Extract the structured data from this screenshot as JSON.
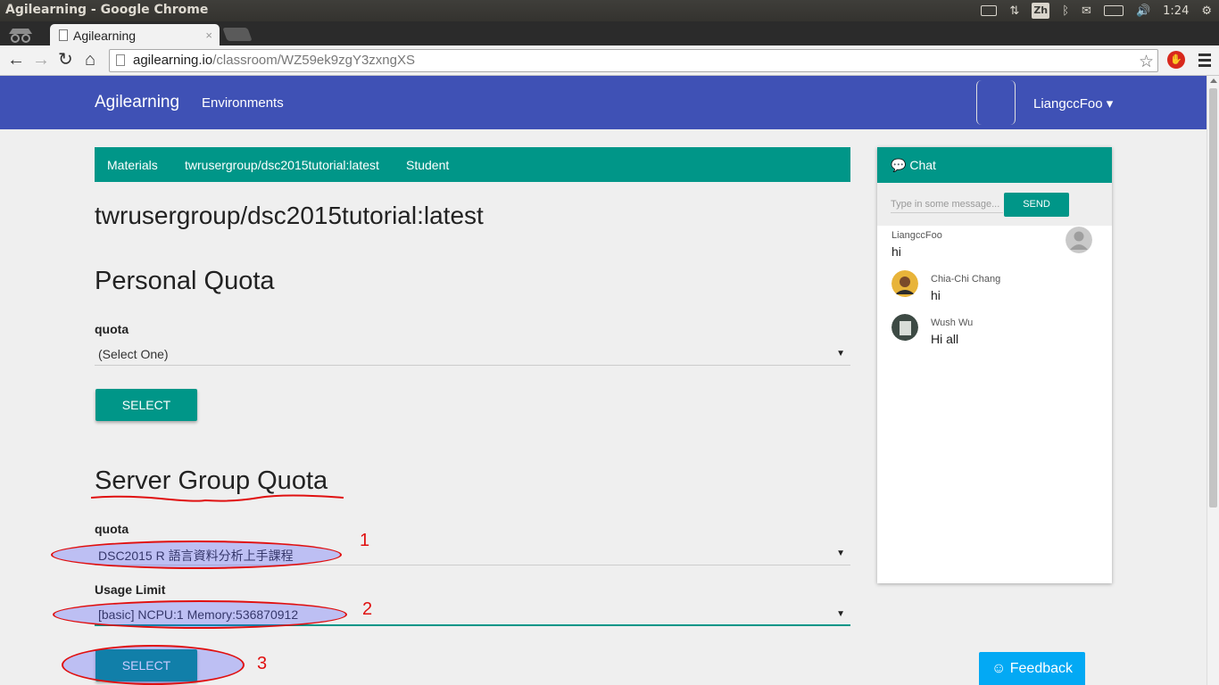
{
  "os": {
    "window_title": "Agilearning - Google Chrome",
    "ime": "Zh",
    "clock": "1:24"
  },
  "browser": {
    "tab_title": "Agilearning",
    "tab_close": "×",
    "url_host": "agilearning.io",
    "url_path": "/classroom/WZ59ek9zgY3zxngXS"
  },
  "navbar": {
    "brand": "Agilearning",
    "environments": "Environments",
    "user": "LiangccFoo ▾"
  },
  "subnav": {
    "materials": "Materials",
    "image": "twrusergroup/dsc2015tutorial:latest",
    "student": "Student"
  },
  "main": {
    "repo_title": "twrusergroup/dsc2015tutorial:latest",
    "personal": {
      "heading": "Personal Quota",
      "quota_label": "quota",
      "quota_value": "(Select One)",
      "select_label": "SELECT"
    },
    "server_group": {
      "heading": "Server Group Quota",
      "quota_label": "quota",
      "quota_value": "DSC2015 R 語言資料分析上手課程",
      "usage_label": "Usage Limit",
      "usage_value": "[basic] NCPU:1 Memory:536870912",
      "select_label": "SELECT"
    }
  },
  "annotations": {
    "n1": "1",
    "n2": "2",
    "n3": "3",
    "color": "#e01010"
  },
  "chat": {
    "title": "Chat",
    "input_placeholder": "Type in some message...",
    "send_label": "SEND",
    "messages": [
      {
        "name": "LiangccFoo",
        "text": "hi"
      },
      {
        "name": "Chia-Chi Chang",
        "text": "hi"
      },
      {
        "name": "Wush Wu",
        "text": "Hi all"
      }
    ]
  },
  "feedback": {
    "label": "☺ Feedback"
  },
  "colors": {
    "navbar": "#3f51b5",
    "teal": "#009688",
    "feedback": "#03a9f4"
  }
}
